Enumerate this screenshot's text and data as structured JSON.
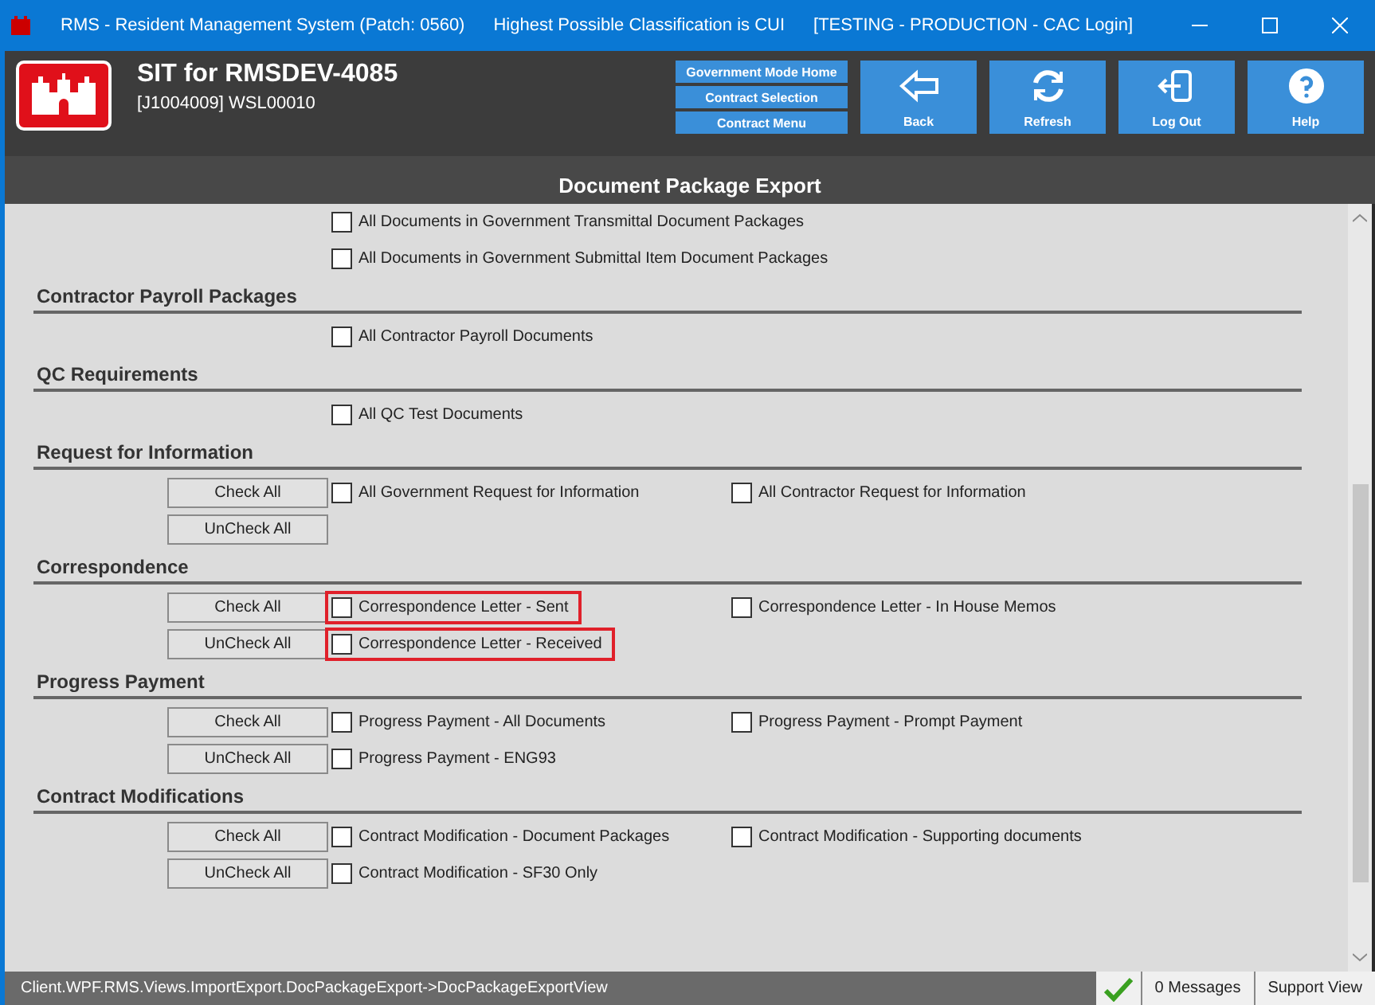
{
  "window": {
    "title_segments": [
      "RMS - Resident Management System (Patch: 0560)",
      "Highest Possible Classification is CUI",
      "[TESTING - PRODUCTION - CAC Login]"
    ]
  },
  "header": {
    "title": "SIT for RMSDEV-4085",
    "subtitle": "[J1004009] WSL00010",
    "nav_links": [
      "Government Mode Home",
      "Contract Selection",
      "Contract Menu"
    ],
    "buttons": [
      {
        "kind": "back",
        "label": "Back"
      },
      {
        "kind": "refresh",
        "label": "Refresh"
      },
      {
        "kind": "logout",
        "label": "Log Out"
      },
      {
        "kind": "help",
        "label": "Help"
      }
    ]
  },
  "page_title": "Document Package Export",
  "sections": [
    {
      "rows": [
        {
          "items": [
            {
              "label": "All Documents in Government Transmittal Document Packages",
              "checked": false,
              "highlighted": false
            }
          ]
        },
        {
          "items": [
            {
              "label": "All Documents in Government Submittal Item Document Packages",
              "checked": false,
              "highlighted": false
            }
          ]
        }
      ]
    },
    {
      "title": "Contractor Payroll Packages",
      "rows": [
        {
          "items": [
            {
              "label": "All Contractor Payroll Documents",
              "checked": false,
              "highlighted": false
            }
          ]
        }
      ]
    },
    {
      "title": "QC Requirements",
      "rows": [
        {
          "items": [
            {
              "label": "All QC Test Documents",
              "checked": false,
              "highlighted": false
            }
          ]
        }
      ]
    },
    {
      "title": "Request for Information",
      "rows": [
        {
          "button": "Check All",
          "items": [
            {
              "label": "All Government Request for Information",
              "checked": false,
              "highlighted": false
            },
            {
              "label": "All Contractor Request for Information",
              "checked": false,
              "highlighted": false
            }
          ]
        },
        {
          "button": "UnCheck All",
          "items": []
        }
      ]
    },
    {
      "title": "Correspondence",
      "rows": [
        {
          "button": "Check All",
          "items": [
            {
              "label": "Correspondence Letter - Sent",
              "checked": false,
              "highlighted": true
            },
            {
              "label": "Correspondence Letter - In House Memos",
              "checked": false,
              "highlighted": false
            }
          ]
        },
        {
          "button": "UnCheck All",
          "items": [
            {
              "label": "Correspondence Letter - Received",
              "checked": false,
              "highlighted": true
            }
          ]
        }
      ]
    },
    {
      "title": "Progress Payment",
      "rows": [
        {
          "button": "Check All",
          "items": [
            {
              "label": "Progress Payment - All Documents",
              "checked": false,
              "highlighted": false
            },
            {
              "label": "Progress Payment - Prompt Payment",
              "checked": false,
              "highlighted": false
            }
          ]
        },
        {
          "button": "UnCheck All",
          "items": [
            {
              "label": "Progress Payment - ENG93",
              "checked": false,
              "highlighted": false
            }
          ]
        }
      ]
    },
    {
      "title": "Contract Modifications",
      "rows": [
        {
          "button": "Check All",
          "items": [
            {
              "label": "Contract Modification - Document Packages",
              "checked": false,
              "highlighted": false
            },
            {
              "label": "Contract Modification - Supporting documents",
              "checked": false,
              "highlighted": false
            }
          ]
        },
        {
          "button": "UnCheck All",
          "items": [
            {
              "label": "Contract Modification - SF30 Only",
              "checked": false,
              "highlighted": false
            }
          ]
        }
      ]
    }
  ],
  "status_bar": {
    "path": "Client.WPF.RMS.Views.ImportExport.DocPackageExport->DocPackageExportView",
    "ok": true,
    "messages": "0 Messages",
    "support": "Support View"
  }
}
